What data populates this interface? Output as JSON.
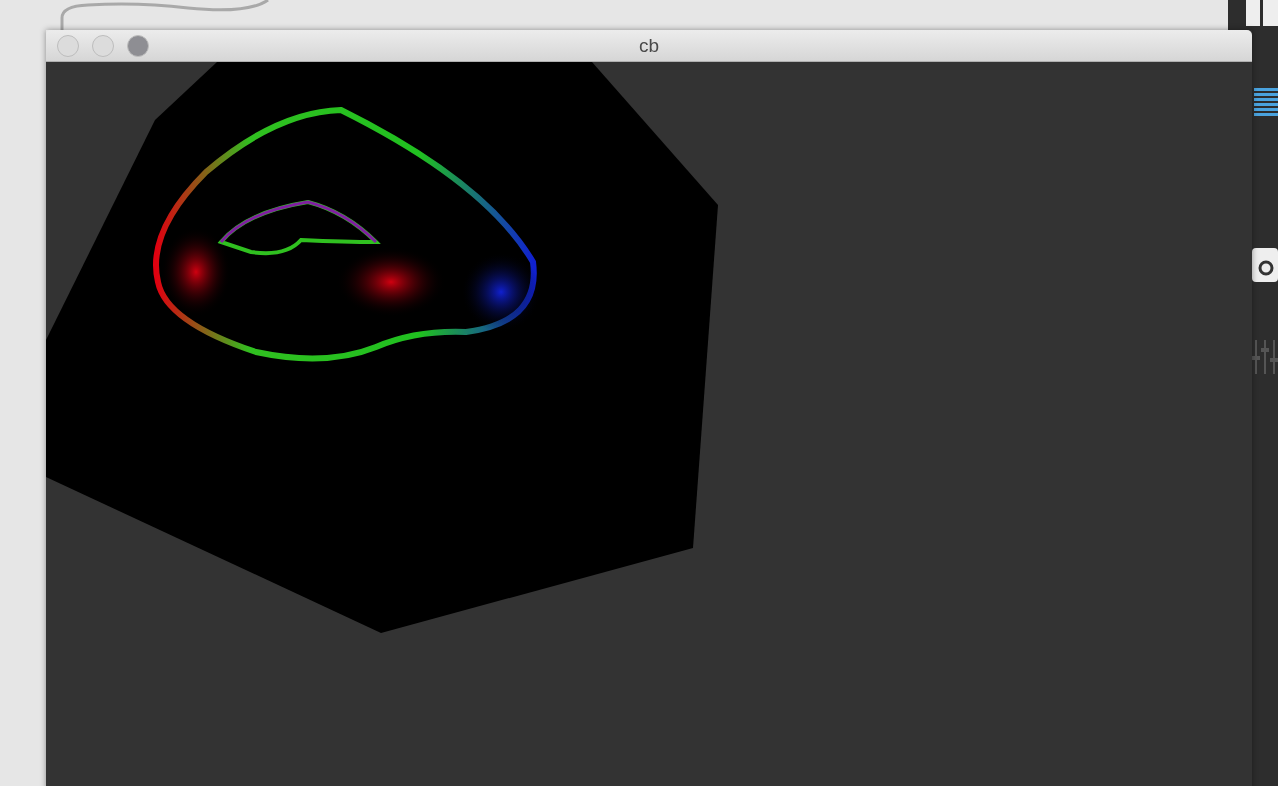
{
  "window": {
    "title": "cb"
  }
}
